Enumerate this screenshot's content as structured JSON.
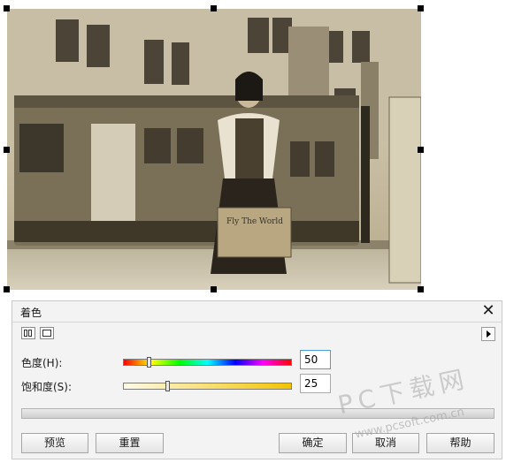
{
  "canvas": {
    "photo_alt": "Sepia photograph of a woman holding a suitcase in front of a vintage tram",
    "suitcase_text": "Fly The World"
  },
  "dialog": {
    "title": "着色",
    "close_icon": "close-icon",
    "hue": {
      "label": "色度(H):",
      "value": "50",
      "slider_fraction": 0.14
    },
    "saturation": {
      "label": "饱和度(S):",
      "value": "25",
      "slider_fraction": 0.25
    },
    "buttons": {
      "preview": "预览",
      "reset": "重置",
      "ok": "确定",
      "cancel": "取消",
      "help": "帮助"
    }
  },
  "watermark": {
    "text": "PC下载网",
    "url": "www.pcsoft.com.cn"
  }
}
